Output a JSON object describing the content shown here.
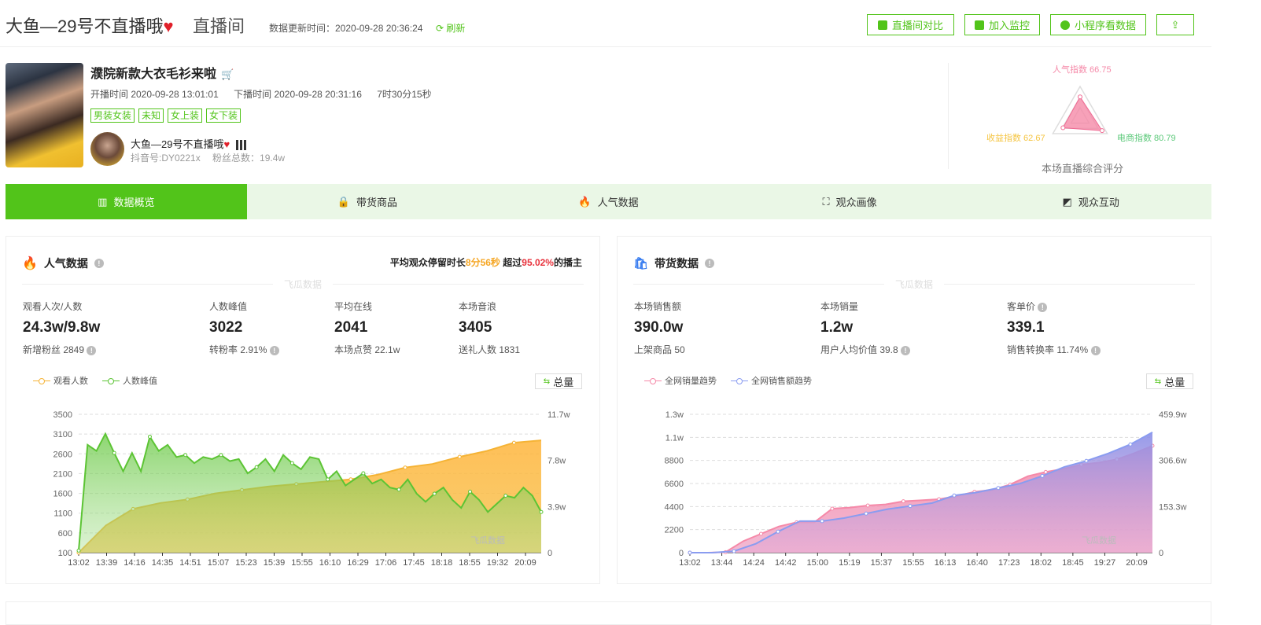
{
  "header": {
    "anchor_title": "大鱼—29号不直播哦",
    "heart": "♥",
    "subtitle": "直播间",
    "update_label": "数据更新时间：2020-09-28 20:36:24",
    "refresh_label": "刷新",
    "buttons": [
      {
        "label": "直播间对比",
        "icon": "compare-icon"
      },
      {
        "label": "加入监控",
        "icon": "monitor-icon"
      },
      {
        "label": "小程序看数据",
        "icon": "mini-program-icon"
      },
      {
        "label": "",
        "icon": "share-icon"
      }
    ]
  },
  "live": {
    "title": "濮院新款大衣毛衫来啦",
    "start_label": "开播时间 2020-09-28 13:01:01",
    "end_label": "下播时间 2020-09-28 20:31:16",
    "duration": "7时30分15秒",
    "tags": [
      "男装女装",
      "未知",
      "女上装",
      "女下装"
    ],
    "anchor_name": "大鱼—29号不直播哦",
    "douyin_id": "抖音号:DY0221x",
    "fans": "粉丝总数：19.4w"
  },
  "radar": {
    "popularity_label": "人气指数 66.75",
    "ecommerce_label": "电商指数 80.79",
    "revenue_label": "收益指数 62.67",
    "values": {
      "popularity": 66.75,
      "ecommerce": 80.79,
      "revenue": 62.67
    },
    "max": 100,
    "caption": "本场直播综合评分",
    "colors": {
      "popularity": "#f589a8",
      "ecommerce": "#5cc97a",
      "revenue": "#f5c542"
    }
  },
  "tabs": [
    {
      "label": "数据概览",
      "icon": "bar-chart-icon",
      "active": true
    },
    {
      "label": "带货商品",
      "icon": "bag-icon",
      "active": false
    },
    {
      "label": "人气数据",
      "icon": "flame-icon",
      "active": false
    },
    {
      "label": "观众画像",
      "icon": "portrait-icon",
      "active": false
    },
    {
      "label": "观众互动",
      "icon": "interaction-icon",
      "active": false
    }
  ],
  "popularity": {
    "title": "人气数据",
    "note_prefix": "平均观众停留时长",
    "note_stay": "8分56秒",
    "note_mid": " 超过",
    "note_pct": "95.02%",
    "note_suffix": "的播主",
    "watermark": "飞瓜数据",
    "metrics": [
      {
        "label": "观看人次/人数",
        "value": "24.3w/9.8w",
        "sub": "新增粉丝 2849"
      },
      {
        "label": "人数峰值",
        "value": "3022",
        "sub": "转粉率 2.91%"
      },
      {
        "label": "平均在线",
        "value": "2041",
        "sub": "本场点赞 22.1w"
      },
      {
        "label": "本场音浪",
        "value": "3405",
        "sub": "送礼人数 1831"
      }
    ],
    "total_label": "总量"
  },
  "sales": {
    "title": "带货数据",
    "watermark": "飞瓜数据",
    "metrics": [
      {
        "label": "本场销售额",
        "value": "390.0w",
        "sub": "上架商品 50"
      },
      {
        "label": "本场销量",
        "value": "1.2w",
        "sub": "用户人均价值 39.8"
      },
      {
        "label": "客单价",
        "value": "339.1",
        "sub": "销售转换率 11.74%"
      }
    ],
    "total_label": "总量"
  },
  "chart_data": [
    {
      "type": "area",
      "title": "人气数据",
      "legend": [
        "观看人数",
        "人数峰值"
      ],
      "legend_placement": "top-left",
      "x": [
        "13:02",
        "13:39",
        "14:16",
        "14:35",
        "14:51",
        "15:07",
        "15:23",
        "15:39",
        "15:55",
        "16:10",
        "16:29",
        "17:06",
        "17:45",
        "18:18",
        "18:55",
        "19:32",
        "20:09"
      ],
      "y_left_ticks": [
        "100",
        "600",
        "1100",
        "1600",
        "2100",
        "2600",
        "3100",
        "3500"
      ],
      "y_left_range": [
        100,
        3500
      ],
      "y_right_ticks": [
        "0",
        "3.9w",
        "7.8w",
        "11.7w"
      ],
      "y_right_range": [
        0,
        117000
      ],
      "series": [
        {
          "name": "观看人数",
          "axis": "right",
          "color": "#f5b335",
          "values": [
            0,
            23000,
            37000,
            42000,
            45000,
            50000,
            53000,
            56000,
            58000,
            60000,
            62000,
            66000,
            72000,
            75000,
            81000,
            86000,
            93000,
            95000
          ]
        },
        {
          "name": "人数峰值",
          "axis": "left",
          "color": "#5cc434",
          "values": [
            150,
            2750,
            2600,
            3022,
            2550,
            2100,
            2550,
            2100,
            2950,
            2600,
            2750,
            2450,
            2500,
            2300,
            2450,
            2400,
            2500,
            2350,
            2400,
            2050,
            2200,
            2400,
            2100,
            2500,
            2300,
            2150,
            2450,
            2400,
            1900,
            2100,
            1750,
            1900,
            2050,
            1800,
            1900,
            1700,
            1650,
            1900,
            1550,
            1350,
            1550,
            1700,
            1400,
            1200,
            1600,
            1400,
            1100,
            1300,
            1500,
            1450,
            1700,
            1500,
            1100
          ]
        }
      ],
      "grid": true
    },
    {
      "type": "area",
      "title": "带货数据",
      "legend": [
        "全网销量趋势",
        "全网销售额趋势"
      ],
      "legend_placement": "top-left",
      "x": [
        "13:02",
        "13:44",
        "14:24",
        "14:42",
        "15:00",
        "15:19",
        "15:37",
        "15:55",
        "16:13",
        "16:40",
        "17:23",
        "18:02",
        "18:45",
        "19:27",
        "20:09"
      ],
      "y_left_ticks": [
        "0",
        "2200",
        "4400",
        "6600",
        "8800",
        "1.1w",
        "1.3w"
      ],
      "y_left_range": [
        0,
        13200
      ],
      "y_right_ticks": [
        "0",
        "153.3w",
        "306.6w",
        "459.9w"
      ],
      "y_right_range": [
        0,
        4599000
      ],
      "series": [
        {
          "name": "全网销量趋势",
          "axis": "left",
          "color": "#f589a8",
          "values": [
            0,
            0,
            50,
            1100,
            1800,
            2500,
            2900,
            2900,
            4200,
            4300,
            4500,
            4600,
            4900,
            5000,
            5100,
            5400,
            5800,
            6000,
            6500,
            7300,
            7700,
            8000,
            8400,
            8600,
            8900,
            9500,
            10200
          ]
        },
        {
          "name": "全网销售额趋势",
          "axis": "right",
          "color": "#8a9cf0",
          "values": [
            0,
            0,
            50000,
            300000,
            700000,
            1050000,
            1050000,
            1150000,
            1300000,
            1450000,
            1550000,
            1650000,
            1900000,
            2000000,
            2150000,
            2300000,
            2550000,
            2850000,
            3050000,
            3300000,
            3600000,
            4000000
          ]
        }
      ],
      "grid": true
    }
  ]
}
